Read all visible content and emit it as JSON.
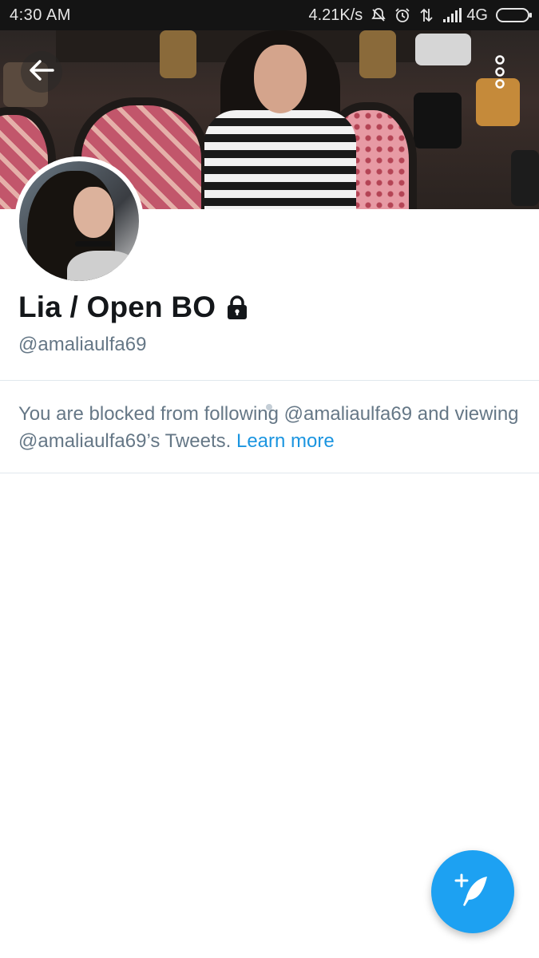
{
  "status_bar": {
    "time": "4:30  AM",
    "network_speed": "4.21K/s",
    "network_type": "4G",
    "icons": [
      "silent-icon",
      "alarm-icon",
      "data-transfer-icon",
      "signal-icon",
      "battery-icon"
    ]
  },
  "header": {
    "back_icon": "arrow-left-icon",
    "more_icon": "more-vertical-icon"
  },
  "profile": {
    "display_name": "Lia / Open BO",
    "protected_icon": "lock-icon",
    "handle": "@amaliaulfa69"
  },
  "notice": {
    "text": "You are blocked from following @amaliaulfa69 and viewing @amaliaulfa69’s Tweets.",
    "link_text": "Learn more"
  },
  "compose": {
    "icon": "compose-tweet-icon"
  },
  "colors": {
    "accent": "#1da1f2",
    "link": "#1b95e0",
    "secondary_text": "#657786",
    "primary_text": "#14171a",
    "divider": "#e1e8ed"
  }
}
